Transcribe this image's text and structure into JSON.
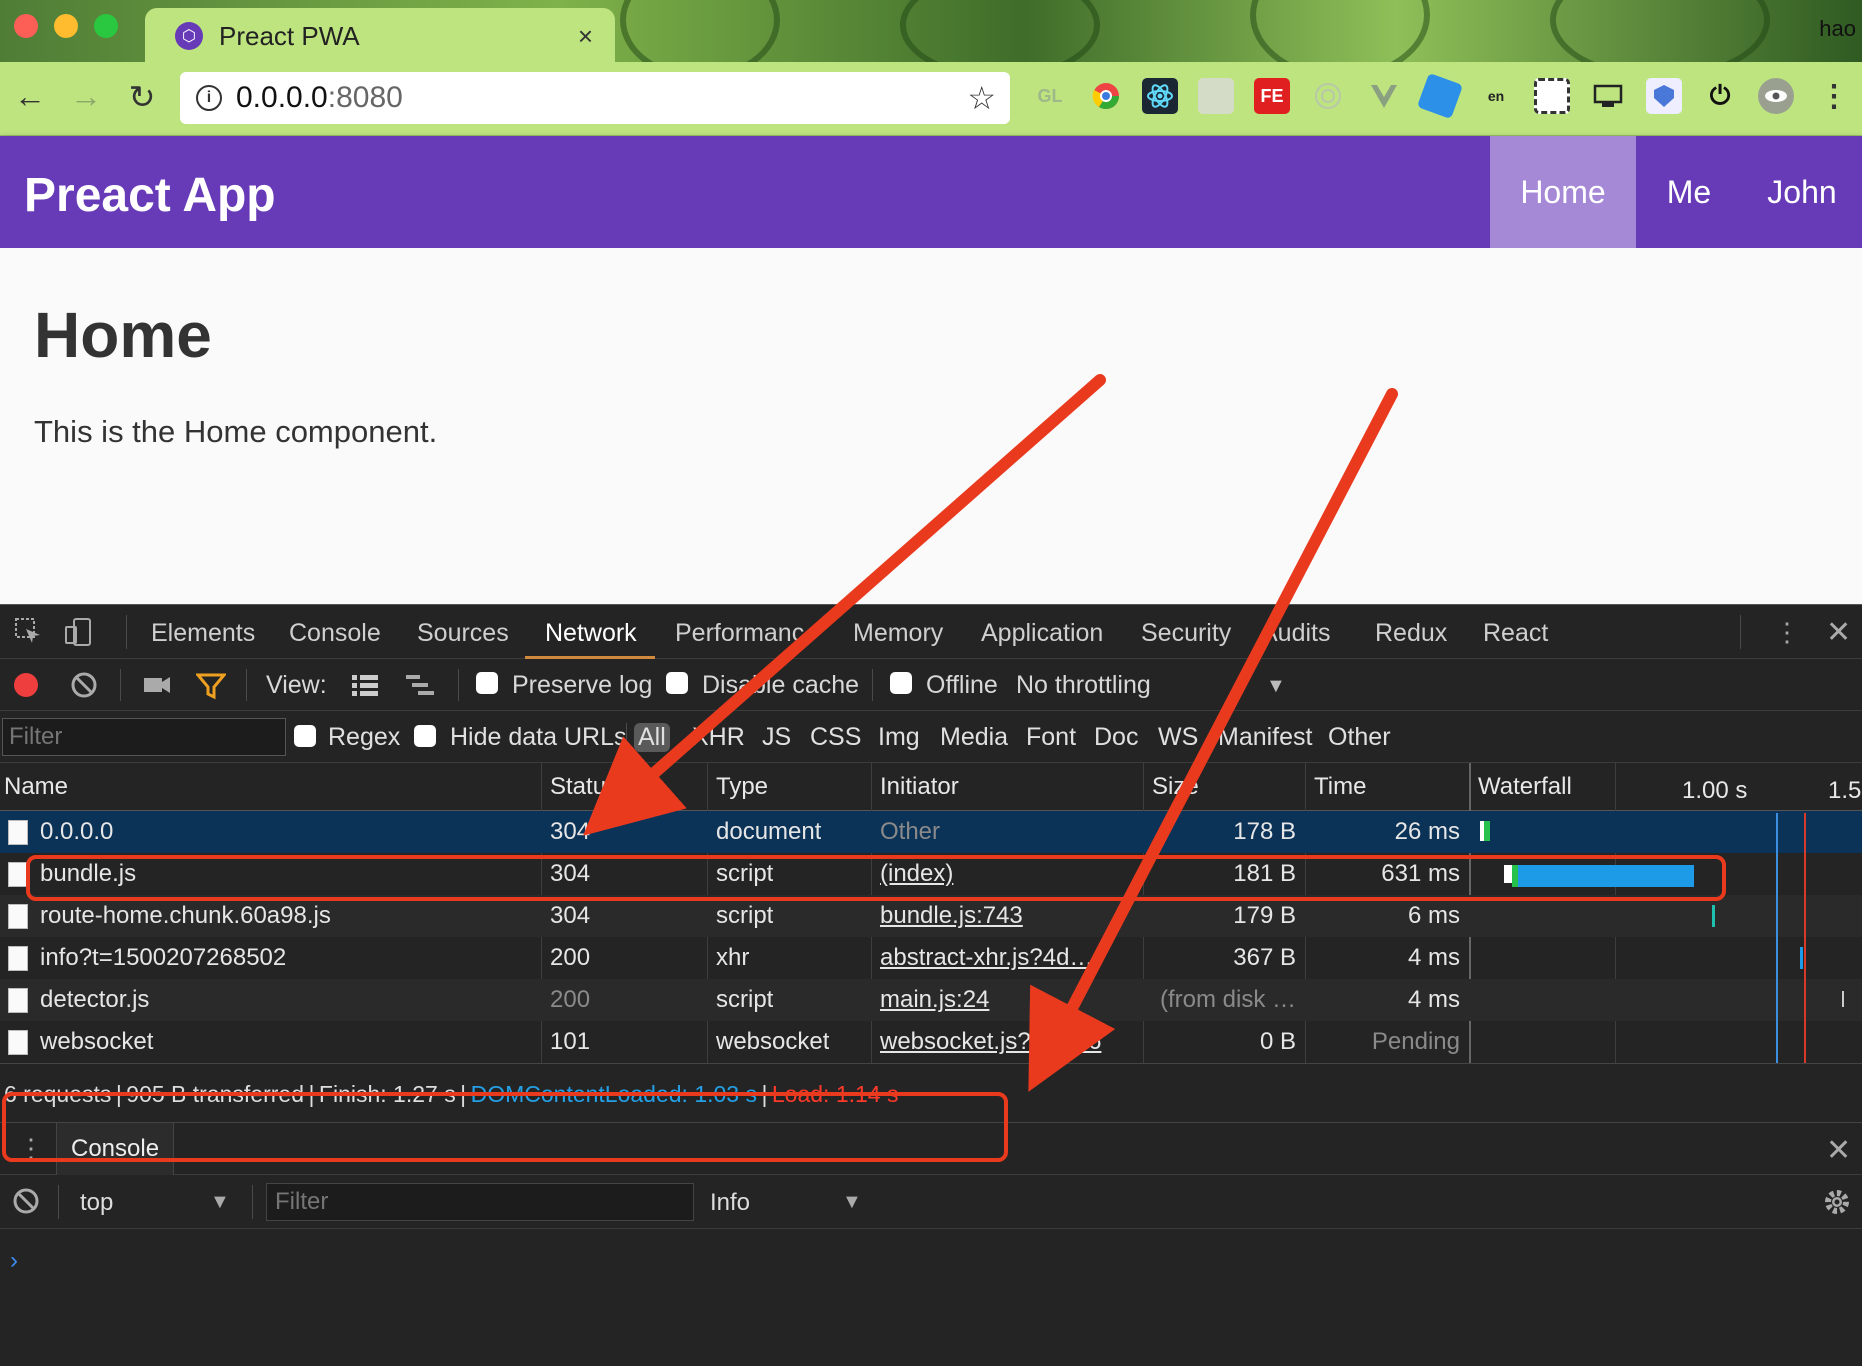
{
  "browser": {
    "tab_title": "Preact PWA",
    "tab_favicon": "preact-icon",
    "tab_close": "×",
    "profile_name": "hao",
    "back": "←",
    "forward": "→",
    "reload": "↻",
    "url_host": "0.0.0.0",
    "url_port": ":8080",
    "info_icon": "i",
    "bookmark_icon": "☆",
    "menu_icon": "⋮",
    "extensions": [
      "GL",
      "chrome-icon",
      "react-icon",
      "notes-icon",
      "FE",
      "target-icon",
      "vue-icon",
      "tag-icon",
      "translate-icon",
      "qr-icon",
      "cast-icon",
      "shield-icon",
      "power-icon",
      "eye-icon"
    ]
  },
  "app": {
    "title": "Preact App",
    "nav": [
      "Home",
      "Me",
      "John"
    ],
    "active_nav": "Home",
    "heading": "Home",
    "body": "This is the Home component."
  },
  "devtools": {
    "tabs": [
      "Elements",
      "Console",
      "Sources",
      "Network",
      "Performance",
      "Memory",
      "Application",
      "Security",
      "Audits",
      "Redux",
      "React"
    ],
    "active_tab": "Network",
    "toolbar": {
      "view_label": "View:",
      "preserve_log": "Preserve log",
      "disable_cache": "Disable cache",
      "offline": "Offline",
      "throttling": "No throttling"
    },
    "filter": {
      "placeholder": "Filter",
      "regex": "Regex",
      "hide_data_urls": "Hide data URLs",
      "types": [
        "All",
        "XHR",
        "JS",
        "CSS",
        "Img",
        "Media",
        "Font",
        "Doc",
        "WS",
        "Manifest",
        "Other"
      ],
      "active_type": "All"
    },
    "columns": [
      "Name",
      "Status",
      "Type",
      "Initiator",
      "Size",
      "Time",
      "Waterfall"
    ],
    "waterfall_ticks": [
      "1.00 s",
      "1.5"
    ],
    "requests": [
      {
        "name": "0.0.0.0",
        "status": "304",
        "type": "document",
        "initiator": "Other",
        "size": "178 B",
        "time": "26 ms"
      },
      {
        "name": "bundle.js",
        "status": "304",
        "type": "script",
        "initiator": "(index)",
        "size": "181 B",
        "time": "631 ms"
      },
      {
        "name": "route-home.chunk.60a98.js",
        "status": "304",
        "type": "script",
        "initiator": "bundle.js:743",
        "size": "179 B",
        "time": "6 ms"
      },
      {
        "name": "info?t=1500207268502",
        "status": "200",
        "type": "xhr",
        "initiator": "abstract-xhr.js?4d…",
        "size": "367 B",
        "time": "4 ms"
      },
      {
        "name": "detector.js",
        "status": "200",
        "type": "script",
        "initiator": "main.js:24",
        "size": "(from disk …",
        "time": "4 ms"
      },
      {
        "name": "websocket",
        "status": "101",
        "type": "websocket",
        "initiator": "websocket.js?…d7:6",
        "size": "0 B",
        "time": "Pending"
      }
    ],
    "summary": {
      "requests": "6 requests",
      "transferred": "905 B transferred",
      "finish": "Finish: 1.27 s",
      "dom_content_loaded": "DOMContentLoaded: 1.03 s",
      "load": "Load: 1.14 s",
      "separator": "|"
    },
    "drawer": {
      "tab": "Console",
      "context": "top",
      "filter_placeholder": "Filter",
      "level": "Info",
      "prompt": "›"
    }
  },
  "colors": {
    "app_header": "#673ab7",
    "nav_active": "#a588d6",
    "annotation": "#ea3a1e",
    "dom_content_loaded": "#25a0e6",
    "load": "#ff3a2a",
    "selected_row": "#0b3257"
  }
}
